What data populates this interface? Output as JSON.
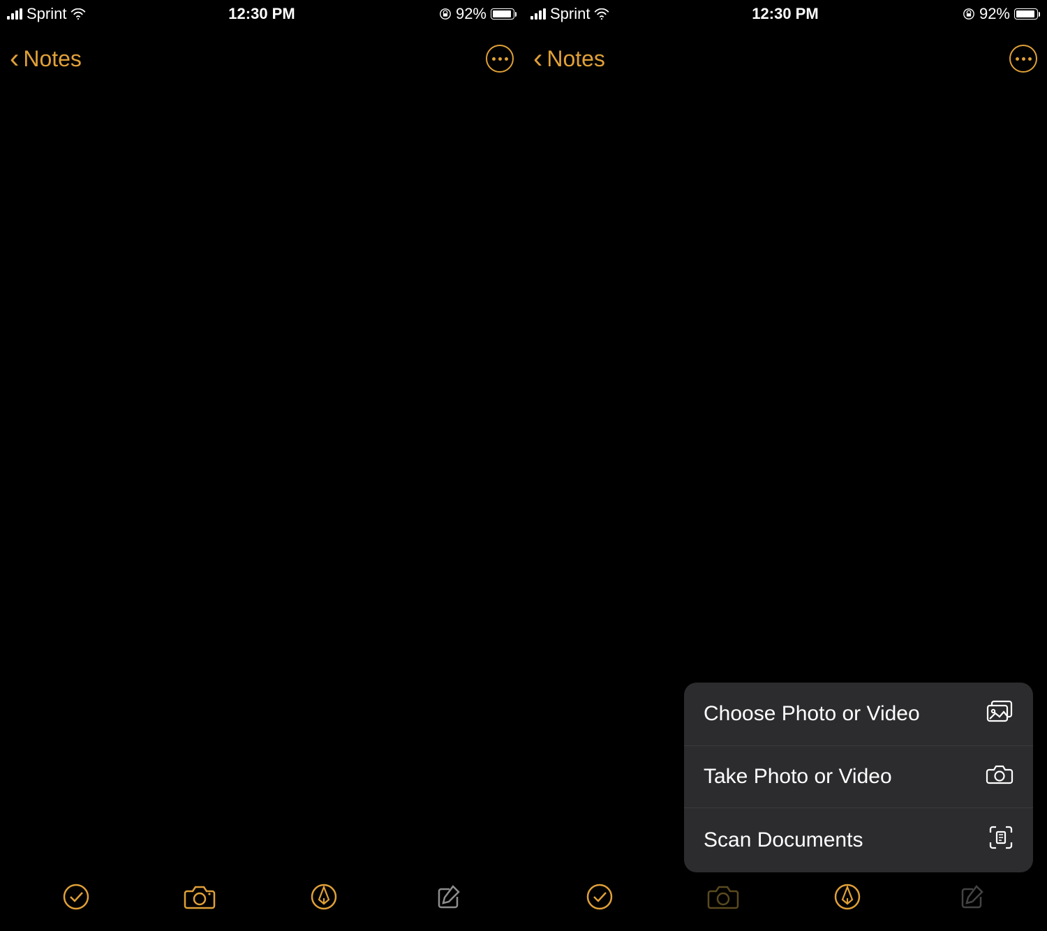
{
  "accent_color": "#e0a038",
  "status": {
    "carrier": "Sprint",
    "time": "12:30 PM",
    "battery_percent": "92%",
    "battery_fill": 92
  },
  "nav": {
    "back_label": "Notes"
  },
  "toolbar": {
    "checklist": "checklist",
    "camera": "camera",
    "markup": "markup",
    "compose": "compose"
  },
  "popover": {
    "items": [
      {
        "label": "Choose Photo or Video",
        "icon": "photo-library"
      },
      {
        "label": "Take Photo or Video",
        "icon": "camera"
      },
      {
        "label": "Scan Documents",
        "icon": "scan"
      }
    ]
  }
}
